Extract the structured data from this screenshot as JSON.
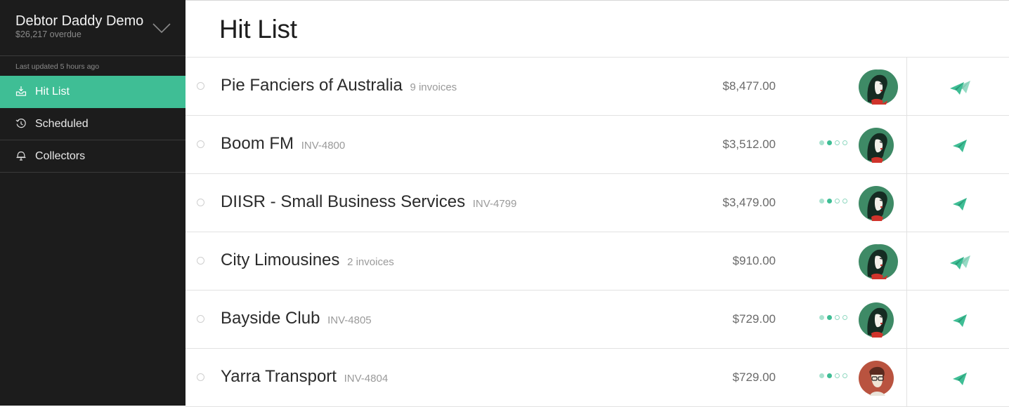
{
  "org": {
    "name": "Debtor Daddy Demo",
    "overdue": "$26,217 overdue"
  },
  "updated": "Last updated 5 hours ago",
  "nav": [
    {
      "label": "Hit List",
      "icon": "inbox-icon"
    },
    {
      "label": "Scheduled",
      "icon": "history-icon"
    },
    {
      "label": "Collectors",
      "icon": "bell-icon"
    }
  ],
  "page_title": "Hit List",
  "colors": {
    "accent": "#3fbe95",
    "sidebar": "#1c1c1c"
  },
  "rows": [
    {
      "name": "Pie Fanciers of Australia",
      "ref": "9 invoices",
      "amount": "$8,477.00",
      "progress": null,
      "avatar": "multi",
      "action": "send-multiple-icon"
    },
    {
      "name": "Boom FM",
      "ref": "INV-4800",
      "amount": "$3,512.00",
      "progress": 2,
      "avatar": "green",
      "action": "send-icon"
    },
    {
      "name": "DIISR - Small Business Services",
      "ref": "INV-4799",
      "amount": "$3,479.00",
      "progress": 2,
      "avatar": "green",
      "action": "send-icon"
    },
    {
      "name": "City Limousines",
      "ref": "2 invoices",
      "amount": "$910.00",
      "progress": null,
      "avatar": "multi",
      "action": "send-multiple-icon"
    },
    {
      "name": "Bayside Club",
      "ref": "INV-4805",
      "amount": "$729.00",
      "progress": 2,
      "avatar": "green",
      "action": "send-icon"
    },
    {
      "name": "Yarra Transport",
      "ref": "INV-4804",
      "amount": "$729.00",
      "progress": 2,
      "avatar": "red",
      "action": "send-icon"
    }
  ]
}
